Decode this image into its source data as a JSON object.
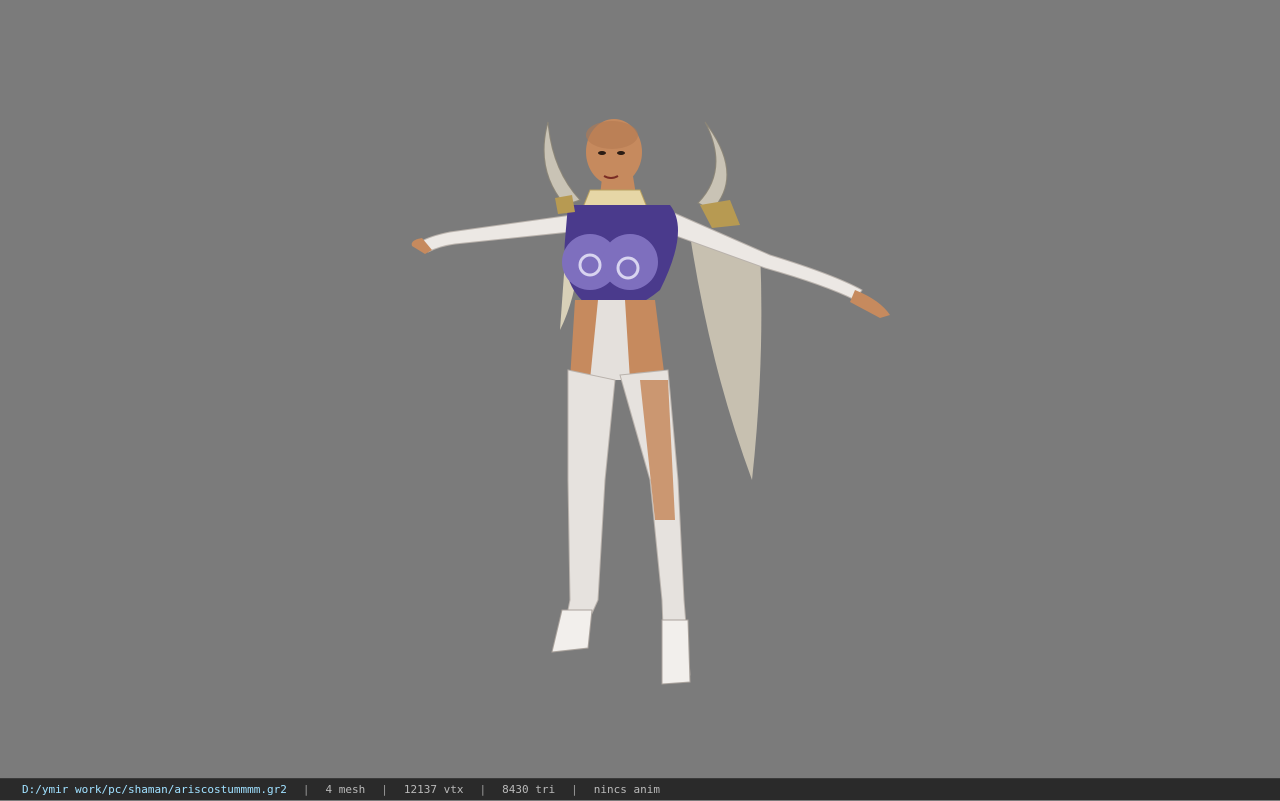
{
  "viewer": {
    "model": {
      "name": "character-model"
    }
  },
  "statusbar": {
    "file_path": "D:/ymir work/pc/shaman/ariscostummmm.gr2",
    "separator": "|",
    "mesh_count": "4 mesh",
    "vertex_count": "12137 vtx",
    "triangle_count": "8430 tri",
    "animation": "nincs anim"
  },
  "colors": {
    "viewport_bg": "#7b7b7b",
    "statusbar_bg": "#2a2a2a",
    "path_text": "#9fe0ff",
    "stat_text": "#b9b9b9"
  }
}
